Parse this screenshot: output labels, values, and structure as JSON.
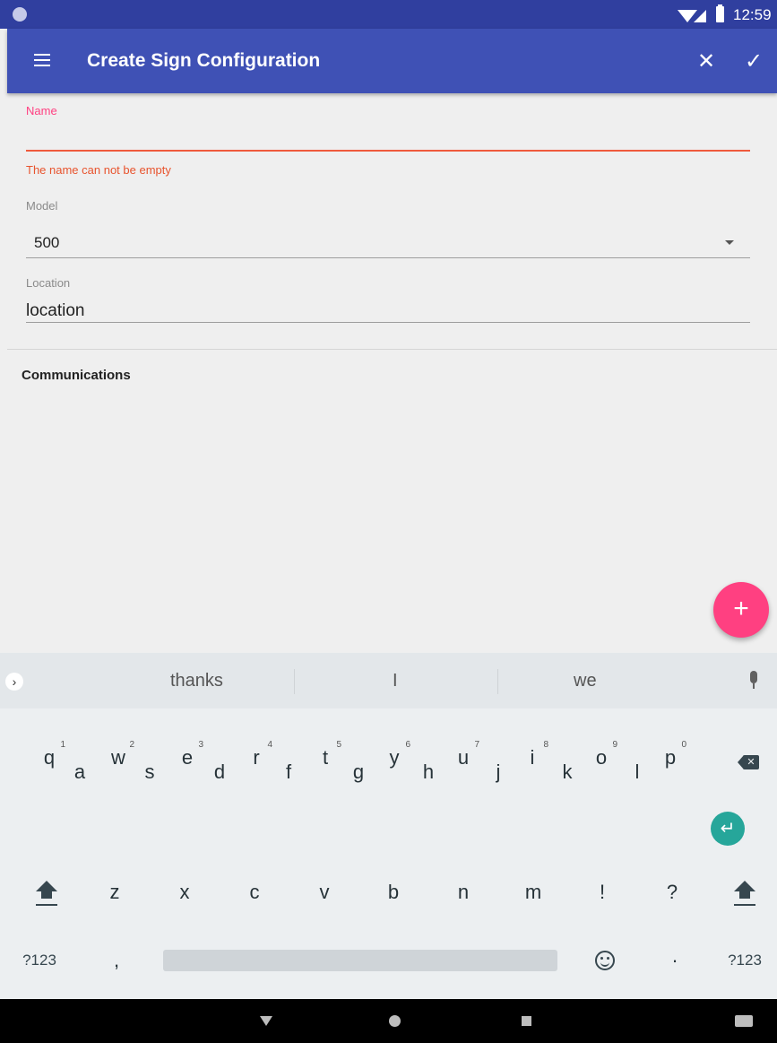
{
  "status_bar": {
    "time": "12:59"
  },
  "app_bar": {
    "title": "Create Sign Configuration"
  },
  "form": {
    "name": {
      "label": "Name",
      "value": "",
      "error": "The name can not be empty"
    },
    "model": {
      "label": "Model",
      "value": "500"
    },
    "location": {
      "label": "Location",
      "value": "location"
    },
    "section_title": "Communications"
  },
  "fab": {
    "label": "+"
  },
  "keyboard": {
    "suggestions": [
      "thanks",
      "I",
      "we"
    ],
    "row1": [
      {
        "key": "q",
        "hint": "1"
      },
      {
        "key": "w",
        "hint": "2"
      },
      {
        "key": "e",
        "hint": "3"
      },
      {
        "key": "r",
        "hint": "4"
      },
      {
        "key": "t",
        "hint": "5"
      },
      {
        "key": "y",
        "hint": "6"
      },
      {
        "key": "u",
        "hint": "7"
      },
      {
        "key": "i",
        "hint": "8"
      },
      {
        "key": "o",
        "hint": "9"
      },
      {
        "key": "p",
        "hint": "0"
      }
    ],
    "row2": [
      "a",
      "s",
      "d",
      "f",
      "g",
      "h",
      "j",
      "k",
      "l"
    ],
    "row3": [
      "z",
      "x",
      "c",
      "v",
      "b",
      "n",
      "m",
      "!",
      "?"
    ],
    "bottom": {
      "symbols_left": "?123",
      "comma": ",",
      "period": "·",
      "symbols_right": "?123"
    }
  }
}
